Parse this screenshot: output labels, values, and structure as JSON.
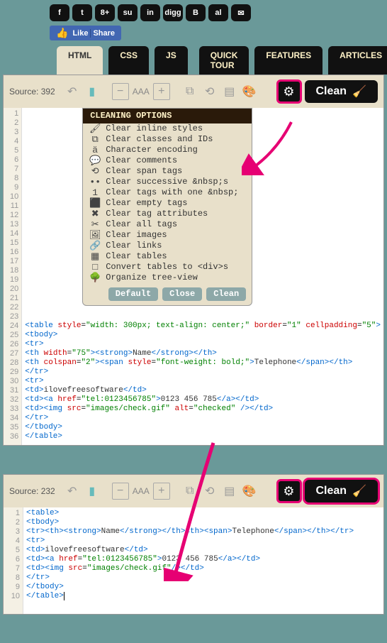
{
  "social": [
    "f",
    "t",
    "8+",
    "su",
    "in",
    "digg",
    "B",
    "al",
    "✉"
  ],
  "fb": {
    "like": "Like",
    "share": "Share"
  },
  "tabs": [
    "HTML",
    "CSS",
    "JS",
    "QUICK TOUR",
    "FEATURES",
    "ARTICLES"
  ],
  "toolbar1": {
    "source": "Source: 392",
    "aaa": "AAA"
  },
  "clean_label": "Clean",
  "options": {
    "title": "CLEANING OPTIONS",
    "items": [
      "Clear inline styles",
      "Clear classes and IDs",
      "Character encoding",
      "Clear comments",
      "Clear span tags",
      "Clear successive &nbsp;s",
      "Clear tags with one &nbsp;",
      "Clear empty tags",
      "Clear tag attributes",
      "Clear all tags",
      "Clear images",
      "Clear links",
      "Clear tables",
      "Convert tables to <div>s",
      "Organize tree-view"
    ],
    "icons": [
      "🖌",
      "⧉",
      "ä",
      "💬",
      "⟲",
      "••",
      "1",
      "⬛",
      "✖",
      "✂",
      "🖼",
      "🔗",
      "▦",
      "□",
      "🌳"
    ],
    "btns": [
      "Default",
      "Close",
      "Clean"
    ]
  },
  "code1": {
    "lines": 36,
    "rows": [
      {
        "n": 24,
        "html": "<span class='tk-t'>&lt;table</span> <span class='tk-a'>style</span>=<span class='tk-v'>\"width: 300px; text-align: center;\"</span> <span class='tk-a'>border</span>=<span class='tk-v'>\"1\"</span> <span class='tk-a'>cellpadding</span>=<span class='tk-v'>\"5\"</span><span class='tk-t'>&gt;</span>"
      },
      {
        "n": 25,
        "html": "<span class='tk-t'>&lt;tbody&gt;</span>"
      },
      {
        "n": 26,
        "html": "<span class='tk-t'>&lt;tr&gt;</span>"
      },
      {
        "n": 27,
        "html": "<span class='tk-t'>&lt;th</span> <span class='tk-a'>width</span>=<span class='tk-v'>\"75\"</span><span class='tk-t'>&gt;&lt;strong&gt;</span><span class='tk-x'>Name</span><span class='tk-t'>&lt;/strong&gt;&lt;/th&gt;</span>"
      },
      {
        "n": 28,
        "html": "<span class='tk-t'>&lt;th</span> <span class='tk-a'>colspan</span>=<span class='tk-v'>\"2\"</span><span class='tk-t'>&gt;&lt;span</span> <span class='tk-a'>style</span>=<span class='tk-v'>\"font-weight: bold;\"</span><span class='tk-t'>&gt;</span><span class='tk-x'>Telephone</span><span class='tk-t'>&lt;/span&gt;&lt;/th&gt;</span>"
      },
      {
        "n": 29,
        "html": "<span class='tk-t'>&lt;/tr&gt;</span>"
      },
      {
        "n": 30,
        "html": "<span class='tk-t'>&lt;tr&gt;</span>"
      },
      {
        "n": 31,
        "html": "<span class='tk-t'>&lt;td&gt;</span><span class='tk-x'>ilovefreesoftware</span><span class='tk-t'>&lt;/td&gt;</span>"
      },
      {
        "n": 32,
        "html": "<span class='tk-t'>&lt;td&gt;&lt;a</span> <span class='tk-a'>href</span>=<span class='tk-v'>\"tel:0123456785\"</span><span class='tk-t'>&gt;</span><span class='tk-x'>0123 456 785</span><span class='tk-t'>&lt;/a&gt;&lt;/td&gt;</span>"
      },
      {
        "n": 33,
        "html": "<span class='tk-t'>&lt;td&gt;&lt;img</span> <span class='tk-a'>src</span>=<span class='tk-v'>\"images/check.gif\"</span> <span class='tk-a'>alt</span>=<span class='tk-v'>\"checked\"</span> <span class='tk-t'>/&gt;&lt;/td&gt;</span>"
      },
      {
        "n": 34,
        "html": "<span class='tk-t'>&lt;/tr&gt;</span>"
      },
      {
        "n": 35,
        "html": "<span class='tk-t'>&lt;/tbody&gt;</span>"
      },
      {
        "n": 36,
        "html": "<span class='tk-t'>&lt;/table&gt;</span>"
      }
    ]
  },
  "toolbar2": {
    "source": "Source: 232",
    "aaa": "AAA"
  },
  "code2": {
    "lines": 10,
    "rows": [
      {
        "n": 1,
        "html": "<span class='tk-t'>&lt;table&gt;</span>"
      },
      {
        "n": 2,
        "html": "<span class='tk-t'>&lt;tbody&gt;</span>"
      },
      {
        "n": 3,
        "html": "<span class='tk-t'>&lt;tr&gt;&lt;th&gt;&lt;strong&gt;</span><span class='tk-x'>Name</span><span class='tk-t'>&lt;/strong&gt;&lt;/th&gt;&lt;th&gt;&lt;span&gt;</span><span class='tk-x'>Telephone</span><span class='tk-t'>&lt;/span&gt;&lt;/th&gt;&lt;/tr&gt;</span>"
      },
      {
        "n": 4,
        "html": "<span class='tk-t'>&lt;tr&gt;</span>"
      },
      {
        "n": 5,
        "html": "<span class='tk-t'>&lt;td&gt;</span><span class='tk-x'>ilovefreesoftware</span><span class='tk-t'>&lt;/td&gt;</span>"
      },
      {
        "n": 6,
        "html": "<span class='tk-t'>&lt;td&gt;&lt;a</span> <span class='tk-a'>href</span>=<span class='tk-v'>\"tel:0123456785\"</span><span class='tk-t'>&gt;</span><span class='tk-x'>0123 456 785</span><span class='tk-t'>&lt;/a&gt;&lt;/td&gt;</span>"
      },
      {
        "n": 7,
        "html": "<span class='tk-t'>&lt;td&gt;&lt;img</span> <span class='tk-a'>src</span>=<span class='tk-v'>\"images/check.gif\"</span><span class='tk-t'>/&gt;&lt;/td&gt;</span>"
      },
      {
        "n": 8,
        "html": "<span class='tk-t'>&lt;/tr&gt;</span>"
      },
      {
        "n": 9,
        "html": "<span class='tk-t'>&lt;/tbody&gt;</span>"
      },
      {
        "n": 10,
        "html": "<span class='tk-t'>&lt;/table&gt;</span><span style='border-left:1px solid #000'></span>"
      }
    ]
  }
}
